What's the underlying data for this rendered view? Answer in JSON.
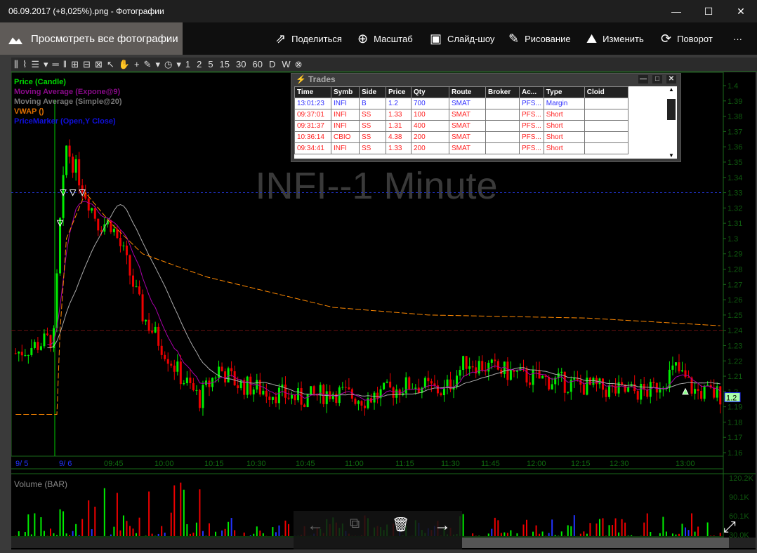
{
  "window": {
    "title": "06.09.2017 (+8,025%).png - Фотографии",
    "minimize": "—",
    "maximize": "☐",
    "close": "✕"
  },
  "commands": {
    "view_all": "Просмотреть все фотографии",
    "share": "Поделиться",
    "zoom": "Масштаб",
    "slideshow": "Слайд-шоу",
    "draw": "Рисование",
    "edit": "Изменить",
    "rotate": "Поворот",
    "more": "···"
  },
  "toolbar": {
    "intervals": [
      "1",
      "2",
      "5",
      "15",
      "30",
      "60",
      "D",
      "W"
    ]
  },
  "legend": {
    "price": "Price (Candle)",
    "ema": "Moving Average (Expone@9)",
    "sma": "Moving Average (Simple@20)",
    "vwap": "VWAP ()",
    "marker": "PriceMarker (Open,Y Close)"
  },
  "watermark": "INFI--1 Minute",
  "volume_label": "Volume (BAR)",
  "trades": {
    "title": "Trades",
    "columns": [
      "Time",
      "Symb",
      "Side",
      "Price",
      "Qty",
      "Route",
      "Broker",
      "Ac...",
      "Type",
      "Cloid"
    ],
    "rows": [
      [
        "13:01:23",
        "INFI",
        "B",
        "1.2",
        "700",
        "SMAT",
        "",
        "PFS...",
        "Margin",
        ""
      ],
      [
        "09:37:01",
        "INFI",
        "SS",
        "1.33",
        "100",
        "SMAT",
        "",
        "PFS...",
        "Short",
        ""
      ],
      [
        "09:31:37",
        "INFI",
        "SS",
        "1.31",
        "400",
        "SMAT",
        "",
        "PFS...",
        "Short",
        ""
      ],
      [
        "10:36:14",
        "CBIO",
        "SS",
        "4.38",
        "200",
        "SMAT",
        "",
        "PFS...",
        "Short",
        ""
      ],
      [
        "09:34:41",
        "INFI",
        "SS",
        "1.33",
        "200",
        "SMAT",
        "",
        "PFS...",
        "Short",
        ""
      ]
    ]
  },
  "colors": {
    "buy": "#3333ff",
    "sell": "#ff2020",
    "up": "#00ee00",
    "down": "#ee0000",
    "ema": "#aa00aa",
    "sma": "#aaaaaa",
    "vwap": "#ff8800",
    "axis": "#1a6a1a"
  },
  "chart_data": {
    "type": "candlestick",
    "title": "INFI--1 Minute",
    "y_ticks": [
      "1.4",
      "1.39",
      "1.38",
      "1.37",
      "1.36",
      "1.35",
      "1.34",
      "1.33",
      "1.32",
      "1.31",
      "1.3",
      "1.29",
      "1.28",
      "1.27",
      "1.26",
      "1.25",
      "1.24",
      "1.23",
      "1.22",
      "1.21",
      "1.2",
      "1.19",
      "1.18",
      "1.17",
      "1.16"
    ],
    "ylim": [
      1.16,
      1.4
    ],
    "x_ticks": [
      "9/ 5",
      "9/ 6",
      "09:45",
      "10:00",
      "10:15",
      "10:30",
      "10:45",
      "11:00",
      "11:15",
      "11:30",
      "11:45",
      "12:00",
      "12:15",
      "12:30",
      "13:00"
    ],
    "last_price": "1.2",
    "price_marker": 1.33,
    "prev_close": 1.24,
    "price_path": [
      [
        0,
        1.225
      ],
      [
        12,
        1.235
      ],
      [
        14,
        1.31
      ],
      [
        16,
        1.36
      ],
      [
        22,
        1.33
      ],
      [
        26,
        1.31
      ],
      [
        30,
        1.31
      ],
      [
        34,
        1.29
      ],
      [
        40,
        1.25
      ],
      [
        46,
        1.23
      ],
      [
        52,
        1.21
      ],
      [
        58,
        1.195
      ],
      [
        64,
        1.215
      ],
      [
        70,
        1.205
      ],
      [
        80,
        1.2
      ],
      [
        90,
        1.195
      ],
      [
        100,
        1.2
      ],
      [
        110,
        1.195
      ],
      [
        125,
        1.205
      ],
      [
        135,
        1.2
      ],
      [
        142,
        1.22
      ],
      [
        150,
        1.215
      ],
      [
        160,
        1.21
      ],
      [
        175,
        1.205
      ],
      [
        190,
        1.2
      ],
      [
        200,
        1.2
      ],
      [
        208,
        1.215
      ],
      [
        214,
        1.2
      ],
      [
        222,
        1.198
      ]
    ],
    "vwap_path": [
      [
        0,
        1.185
      ],
      [
        13,
        1.185
      ],
      [
        14,
        1.24
      ],
      [
        16,
        1.3
      ],
      [
        22,
        1.33
      ],
      [
        30,
        1.31
      ],
      [
        40,
        1.29
      ],
      [
        60,
        1.275
      ],
      [
        80,
        1.265
      ],
      [
        100,
        1.255
      ],
      [
        130,
        1.25
      ],
      [
        180,
        1.248
      ],
      [
        222,
        1.243
      ]
    ],
    "volume_ticks": [
      "120.2K",
      "90.1K",
      "60.1K",
      "30.0K"
    ]
  }
}
